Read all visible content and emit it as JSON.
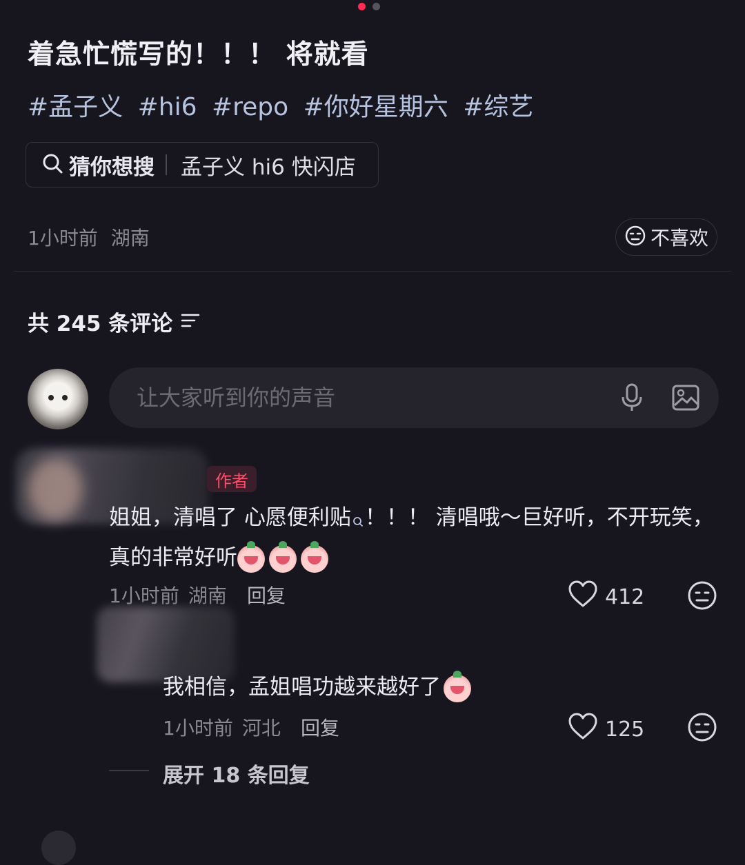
{
  "carousel": {
    "total": 2,
    "active": 0
  },
  "post": {
    "title": "着急忙慌写的！！！ 将就看",
    "tags": [
      "#孟子义",
      "#hi6",
      "#repo",
      "#你好星期六",
      "#综艺"
    ],
    "search_suggestion": {
      "label": "猜你想搜",
      "query": "孟子义 hi6 快闪店"
    },
    "time": "1小时前",
    "location": "湖南",
    "dislike_label": "不喜欢"
  },
  "comments_header": {
    "label": "共 245 条评论"
  },
  "comment_input": {
    "placeholder": "让大家听到你的声音"
  },
  "comments": [
    {
      "badge": "作者",
      "text": "姐姐，清唱了 心愿便利贴",
      "text_tail": "！！！ 清唱哦～巨好听，不开玩笑，真的非常好听",
      "time": "1小时前",
      "location": "湖南",
      "reply_label": "回复",
      "likes": "412"
    },
    {
      "text": "我相信，孟姐唱功越来越好了",
      "time": "1小时前",
      "location": "河北",
      "reply_label": "回复",
      "likes": "125"
    }
  ],
  "expand_replies": "展开 18 条回复",
  "colors": {
    "background": "#17161f",
    "accent": "#fe2c55",
    "tag": "#b7c4e0"
  }
}
